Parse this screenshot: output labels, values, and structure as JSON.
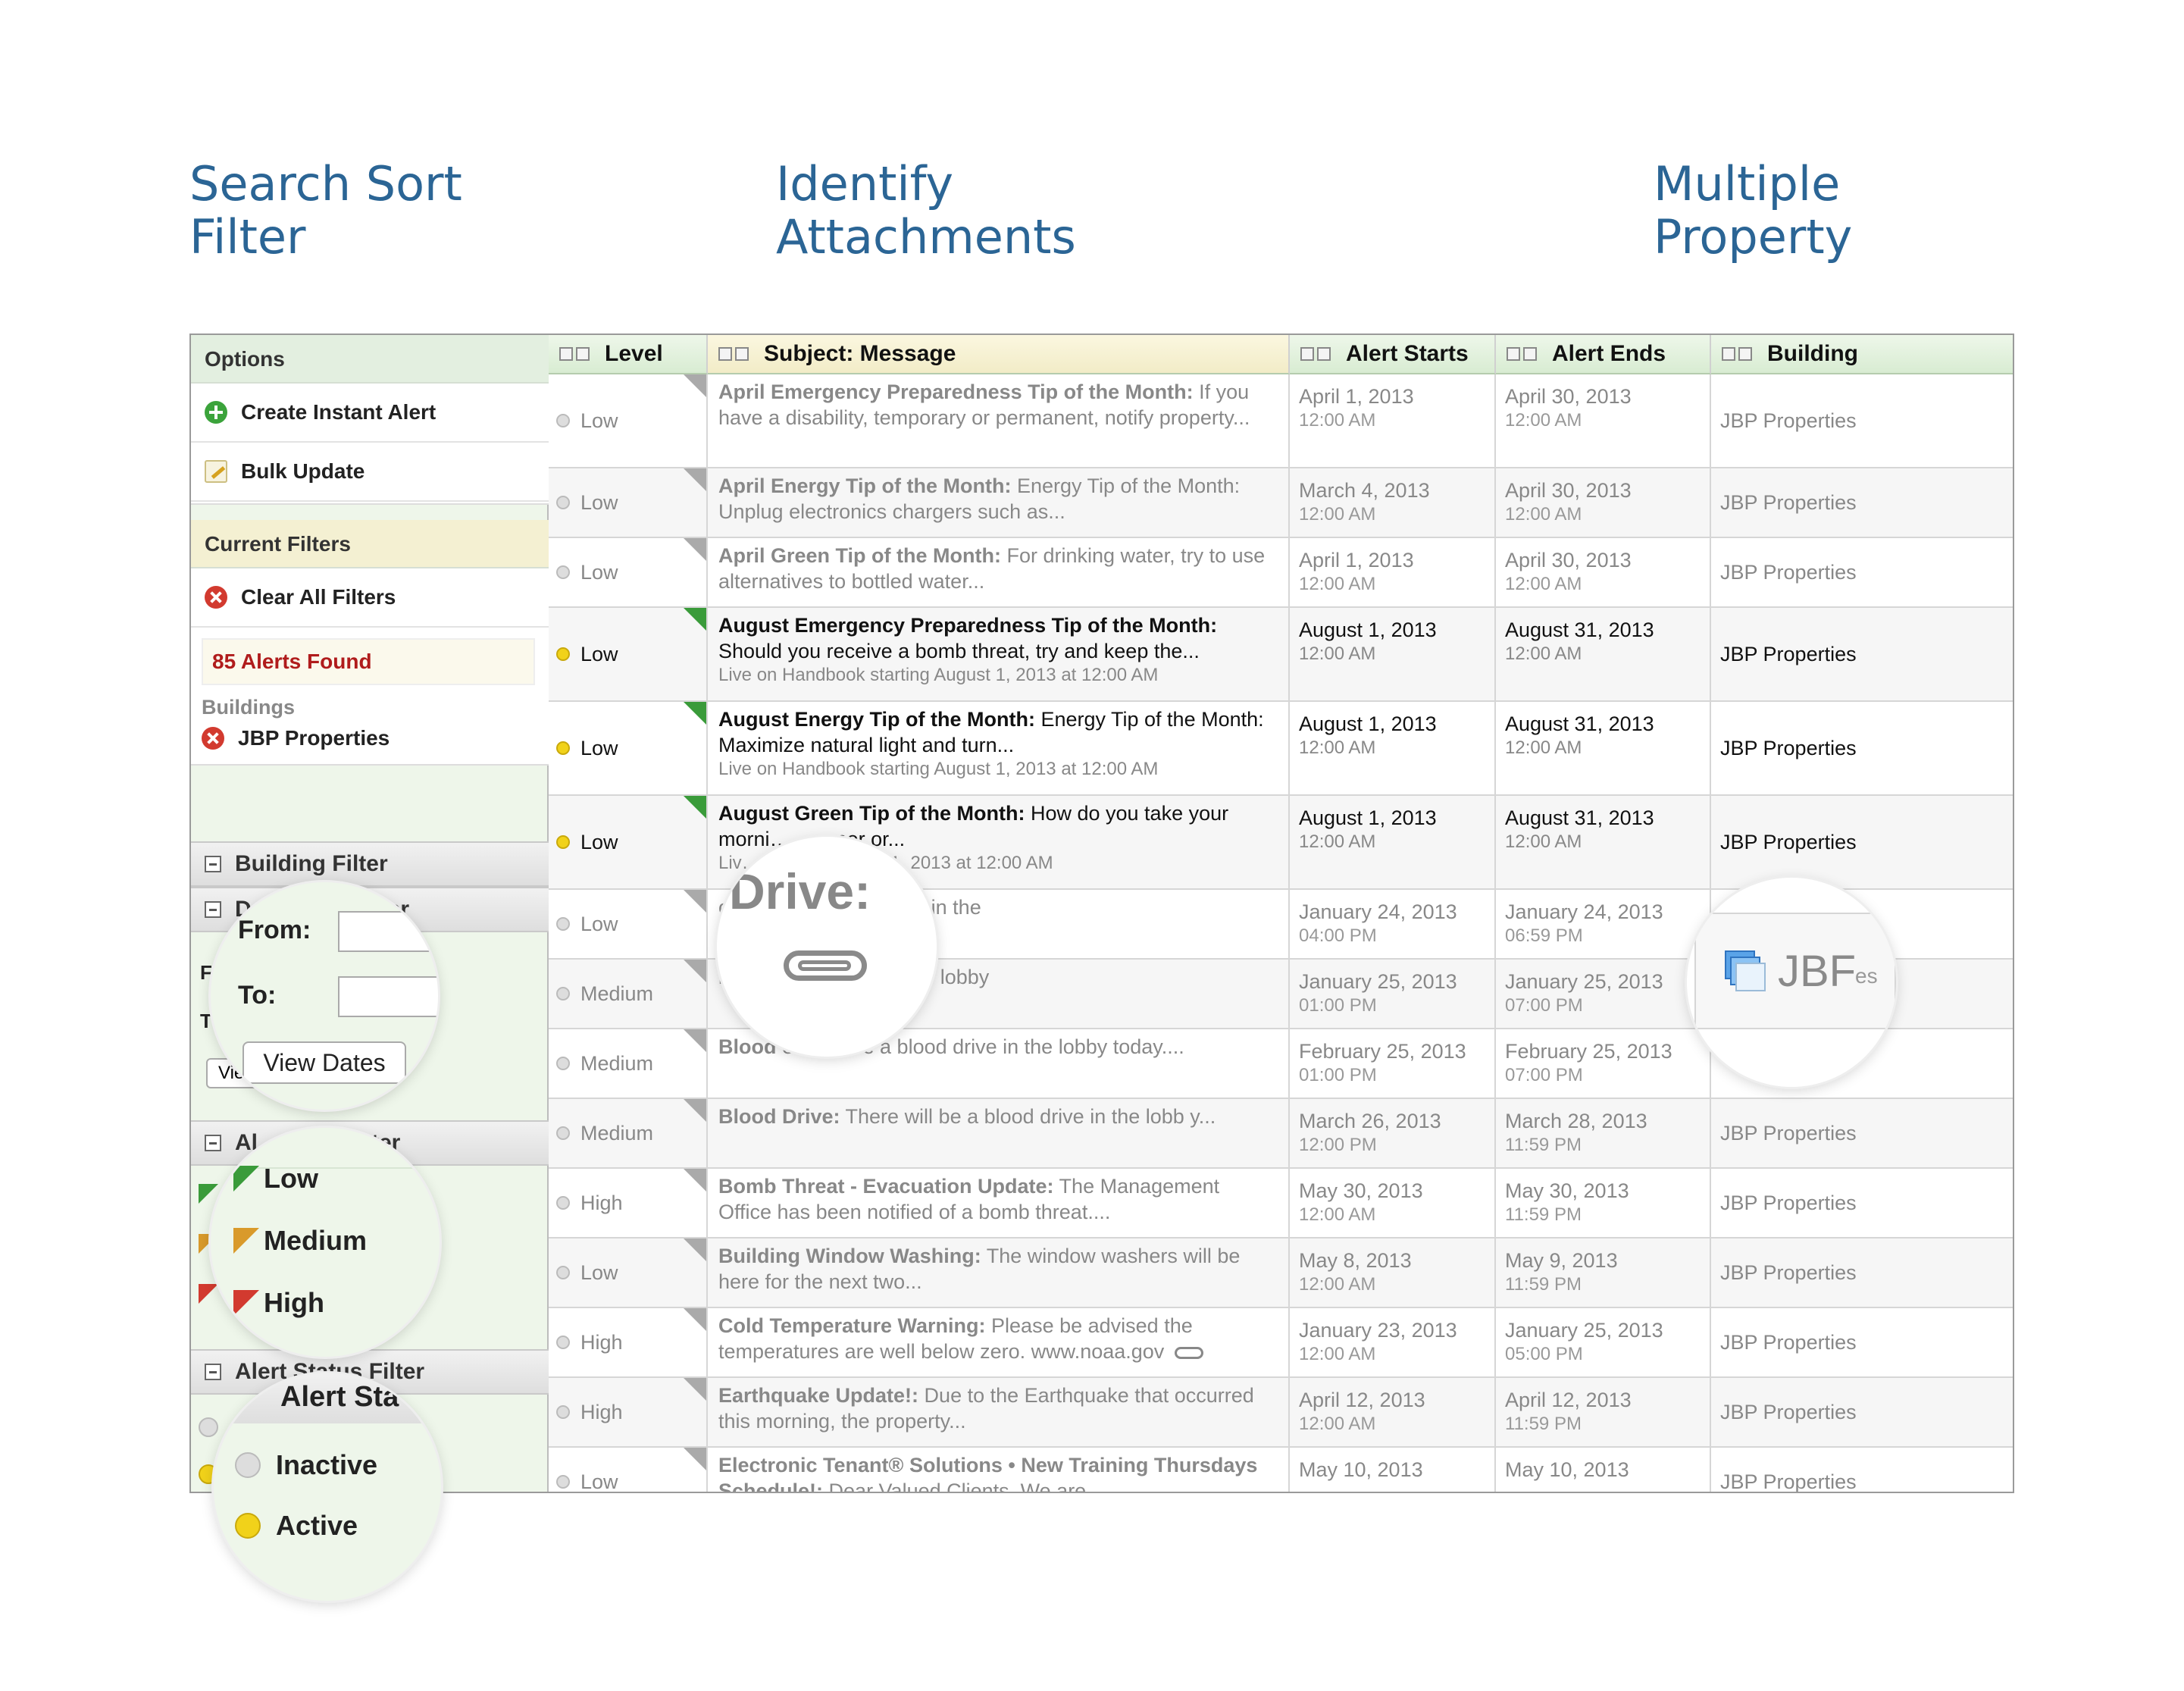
{
  "headings": {
    "search": "Search Sort\nFilter",
    "identify": "Identify\nAttachments",
    "multiple": "Multiple\nProperty"
  },
  "sidebar": {
    "options_title": "Options",
    "create_alert": "Create Instant Alert",
    "bulk_update": "Bulk Update",
    "current_filters_title": "Current Filters",
    "clear_filters": "Clear All Filters",
    "alerts_found": "85 Alerts Found",
    "buildings_label": "Buildings",
    "building_filter_value": "JBP Properties",
    "building_filter": "Building Filter",
    "date_filter": "D",
    "date_filter_tail": "er",
    "from_label": "From:",
    "to_label": "To:",
    "view_dates": "View Dates",
    "view_dates_bg": "Vie",
    "alert_level_filter": "Al",
    "alert_level_filter_tail": "ter",
    "levels": [
      "Low",
      "Medium",
      "High"
    ],
    "alert_status_filter": "Alert Status Filter",
    "status_heading": "Alert Sta",
    "statuses": [
      "Inactive",
      "Active"
    ]
  },
  "columns": {
    "level": "Level",
    "subject": "Subject: Message",
    "starts": "Alert Starts",
    "ends": "Alert Ends",
    "building": "Building"
  },
  "rows": [
    {
      "level": "Low",
      "active": false,
      "title": "April Emergency Preparedness Tip of the Month:",
      "body": " If you have a disability, temporary or permanent, notify property...",
      "live": "",
      "start_date": "April 1, 2013",
      "start_time": "12:00 AM",
      "end_date": "April 30, 2013",
      "end_time": "12:00 AM",
      "building": "JBP Properties"
    },
    {
      "level": "Low",
      "active": false,
      "title": "April Energy Tip of the Month:",
      "body": " Energy Tip of the Month: Unplug electronics chargers such as...",
      "live": "",
      "start_date": "March 4, 2013",
      "start_time": "12:00 AM",
      "end_date": "April 30, 2013",
      "end_time": "12:00 AM",
      "building": "JBP Properties"
    },
    {
      "level": "Low",
      "active": false,
      "title": "April Green Tip of the Month:",
      "body": " For drinking water, try to use alternatives to bottled water...",
      "live": "",
      "start_date": "April 1, 2013",
      "start_time": "12:00 AM",
      "end_date": "April 30, 2013",
      "end_time": "12:00 AM",
      "building": "JBP Properties"
    },
    {
      "level": "Low",
      "active": true,
      "title": "August Emergency Preparedness Tip of the Month:",
      "body": " Should you receive a bomb threat, try and keep the...",
      "live": "Live on Handbook starting August 1, 2013 at 12:00 AM",
      "start_date": "August 1, 2013",
      "start_time": "12:00 AM",
      "end_date": "August 31, 2013",
      "end_time": "12:00 AM",
      "building": "JBP Properties"
    },
    {
      "level": "Low",
      "active": true,
      "title": "August Energy Tip of the Month:",
      "body": " Energy Tip of the Month: Maximize natural light and turn...",
      "live": "Live on Handbook starting August 1, 2013 at 12:00 AM",
      "start_date": "August 1, 2013",
      "start_time": "12:00 AM",
      "end_date": "August 31, 2013",
      "end_time": "12:00 AM",
      "building": "JBP Properties"
    },
    {
      "level": "Low",
      "active": true,
      "title": "August Green Tip of the Month:",
      "body": " How do you take your morni… – paper or...",
      "live": "Liv… starting August 1, 2013 at 12:00 AM",
      "start_date": "August 1, 2013",
      "start_time": "12:00 AM",
      "end_date": "August 31, 2013",
      "end_time": "12:00 AM",
      "building": "JBP Properties"
    },
    {
      "level": "Low",
      "active": false,
      "title": "",
      "body": "oin us for a blood drive in the",
      "live": "",
      "start_date": "January 24, 2013",
      "start_time": "04:00 PM",
      "end_date": "January 24, 2013",
      "end_time": "06:59 PM",
      "building": ""
    },
    {
      "level": "Medium",
      "active": false,
      "title": "",
      "body": "ll be a blood drive in the lobby",
      "live": "",
      "start_date": "January 25, 2013",
      "start_time": "01:00 PM",
      "end_date": "January 25, 2013",
      "end_time": "07:00 PM",
      "building": ""
    },
    {
      "level": "Medium",
      "active": false,
      "title": "Blood",
      "body": "   ere will be a blood drive in the lobby today....",
      "live": "",
      "start_date": "February 25, 2013",
      "start_time": "01:00 PM",
      "end_date": "February 25, 2013",
      "end_time": "07:00 PM",
      "building": ""
    },
    {
      "level": "Medium",
      "active": false,
      "title": "Blood Drive:",
      "body": " There will be a blood drive in the lobb y...",
      "live": "",
      "start_date": "March 26, 2013",
      "start_time": "12:00 PM",
      "end_date": "March 28, 2013",
      "end_time": "11:59 PM",
      "building": "JBP Properties"
    },
    {
      "level": "High",
      "active": false,
      "title": "Bomb Threat - Evacuation Update:",
      "body": " The Management Office has been notified of a bomb threat....",
      "live": "",
      "start_date": "May 30, 2013",
      "start_time": "12:00 AM",
      "end_date": "May 30, 2013",
      "end_time": "11:59 PM",
      "building": "JBP Properties"
    },
    {
      "level": "Low",
      "active": false,
      "title": "Building Window Washing:",
      "body": " The window washers will be here for the next two...",
      "live": "",
      "start_date": "May 8, 2013",
      "start_time": "12:00 AM",
      "end_date": "May 9, 2013",
      "end_time": "11:59 PM",
      "building": "JBP Properties"
    },
    {
      "level": "High",
      "active": false,
      "title": "Cold Temperature Warning:",
      "body": " Please be advised the temperatures are well below zero. www.noaa.gov",
      "live": "",
      "start_date": "January 23, 2013",
      "start_time": "12:00 AM",
      "end_date": "January 25, 2013",
      "end_time": "05:00 PM",
      "building": "JBP Properties"
    },
    {
      "level": "High",
      "active": false,
      "title": "Earthquake Update!:",
      "body": " Due to the Earthquake that occurred this morning, the property...",
      "live": "",
      "start_date": "April 12, 2013",
      "start_time": "12:00 AM",
      "end_date": "April 12, 2013",
      "end_time": "11:59 PM",
      "building": "JBP Properties"
    },
    {
      "level": "Low",
      "active": false,
      "title": "Electronic Tenant® Solutions • New Training Thursdays Schedule!:",
      "body": " Dear Valued Clients, We are...",
      "live": "",
      "start_date": "May 10, 2013",
      "start_time": "",
      "end_date": "May 10, 2013",
      "end_time": "",
      "building": "JBP Properties"
    }
  ],
  "magnifiers": {
    "attachment_title": "Drive:",
    "building_text": "JBF",
    "building_tail": "es"
  },
  "colors": {
    "heading": "#2b6595",
    "green_flag": "#3a9b3a",
    "orange_flag": "#d99a2b",
    "red_flag": "#d23a2f",
    "active_dot": "#f1d21a",
    "alerts_found": "#b01c1c"
  }
}
